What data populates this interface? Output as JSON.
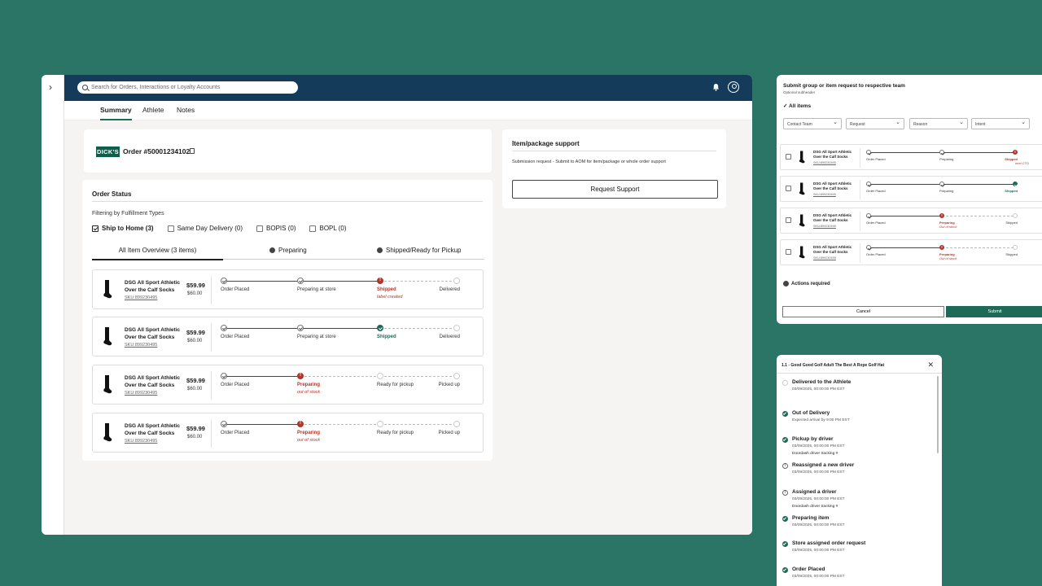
{
  "header": {
    "search_placeholder": "Search for Orders, Interactions or Loyalty Accounts"
  },
  "tabs": [
    {
      "label": "Summary",
      "active": true
    },
    {
      "label": "Athlete",
      "active": false
    },
    {
      "label": "Notes",
      "active": false
    }
  ],
  "order": {
    "logo_text": "DICK'S",
    "number": "Order #50001234102"
  },
  "status": {
    "title": "Order Status",
    "filter_label": "Filtering by Fulfillment Types",
    "filters": [
      {
        "label": "Ship to Home (3)",
        "checked": true
      },
      {
        "label": "Same Day Delivery (0)",
        "checked": false
      },
      {
        "label": "BOPIS (0)",
        "checked": false
      },
      {
        "label": "BOPL (0)",
        "checked": false
      }
    ],
    "subtabs": [
      "All Item Overview (3 items)",
      "Preparing",
      "Shipped/Ready for Pickup"
    ]
  },
  "items": [
    {
      "name": "DSG All Sport Athletic Over the Calf Socks",
      "sku": "SKU:899230495",
      "price": "$59.99",
      "price2": "$60.00",
      "steps": [
        "Order Placed",
        "Preparing at store",
        "Shipped",
        "Delivered"
      ],
      "current": 2,
      "current_state": "red",
      "sub": "label created"
    },
    {
      "name": "DSG All Sport Athletic Over the Calf Socks",
      "sku": "SKU:899230495",
      "price": "$59.99",
      "price2": "$60.00",
      "steps": [
        "Order Placed",
        "Preparing at store",
        "Shipped",
        "Delivered"
      ],
      "current": 2,
      "current_state": "green",
      "sub": ""
    },
    {
      "name": "DSG All Sport Athletic Over the Calf Socks",
      "sku": "SKU:899230495",
      "price": "$59.99",
      "price2": "$60.00",
      "steps": [
        "Order Placed",
        "Preparing",
        "Ready for pickup",
        "Picked up"
      ],
      "current": 1,
      "current_state": "red",
      "sub": "out of stock"
    },
    {
      "name": "DSG All Sport Athletic Over the Calf Socks",
      "sku": "SKU:899230495",
      "price": "$59.99",
      "price2": "$60.00",
      "steps": [
        "Order Placed",
        "Preparing",
        "Ready for pickup",
        "Picked up"
      ],
      "current": 1,
      "current_state": "red",
      "sub": "out of stock"
    }
  ],
  "support": {
    "title": "Item/package support",
    "desc": "Submission request - Submit to AOM for item/package or whole order support",
    "button": "Request Support"
  },
  "request_panel": {
    "title": "Submit group or item request to respective team",
    "subtitle": "Optional subheader",
    "all_items": "All items",
    "dropdowns": [
      "Contact Team",
      "Request",
      "Reason",
      "Intent"
    ],
    "rows": [
      {
        "name": "DSG All Sport Athletic Over the Calf Socks",
        "sku": "SKU:899230495",
        "steps": [
          "Order Placed",
          "Preparing",
          "Shipped"
        ],
        "current": 2,
        "current_state": "red",
        "sub": "next CTO"
      },
      {
        "name": "DSG All Sport Athletic Over the Calf Socks",
        "sku": "SKU:899230495",
        "steps": [
          "Order Placed",
          "Preparing",
          "Shipped"
        ],
        "current": 2,
        "current_state": "green",
        "sub": ""
      },
      {
        "name": "DSG All Sport Athletic Over the Calf Socks",
        "sku": "SKU:899230495",
        "steps": [
          "Order Placed",
          "Preparing",
          "Shipped"
        ],
        "current": 1,
        "current_state": "red",
        "sub": "Out of stock"
      },
      {
        "name": "DSG All Sport Athletic Over the Calf Socks",
        "sku": "SKU:899230495",
        "steps": [
          "Order Placed",
          "Preparing",
          "Shipped"
        ],
        "current": 1,
        "current_state": "red",
        "sub": "Out of stock"
      }
    ],
    "actions": "Actions required",
    "cancel": "Cancel",
    "submit": "Submit"
  },
  "history": {
    "title": "1.1 - Good Good Golf Adult The Best A Rope Golf Hat",
    "events": [
      {
        "title": "Delivered to the Athlete",
        "date": "03/09/2025, 00:00:00 PM EST",
        "note": "",
        "state": "none"
      },
      {
        "title": "Out of Delivery",
        "date": "Expected arrival by 9:00 PM EST",
        "note": "",
        "state": "green"
      },
      {
        "title": "Pickup by driver",
        "date": "03/09/2025, 00:00:00 PM EST",
        "note": "Doordash driver tracking #",
        "state": "green"
      },
      {
        "title": "Reassigned a new driver",
        "date": "03/09/2025, 00:00:00 PM EST",
        "note": "",
        "state": "warn"
      },
      {
        "title": "Assigned a driver",
        "date": "03/09/2025, 00:00:00 PM EST",
        "note": "Doordash driver tracking #",
        "state": "warn"
      },
      {
        "title": "Preparing item",
        "date": "03/09/2025, 00:00:00 PM EST",
        "note": "",
        "state": "green"
      },
      {
        "title": "Store assigned order request",
        "date": "03/09/2025, 00:00:00 PM EST",
        "note": "",
        "state": "green"
      },
      {
        "title": "Order Placed",
        "date": "03/09/2025, 00:00:00 PM EST",
        "note": "",
        "state": "green"
      }
    ]
  },
  "colors": {
    "background": "#2a7566",
    "topbar": "#143b5a",
    "brand_green": "#1e6a58",
    "alert_red": "#b1362b"
  }
}
